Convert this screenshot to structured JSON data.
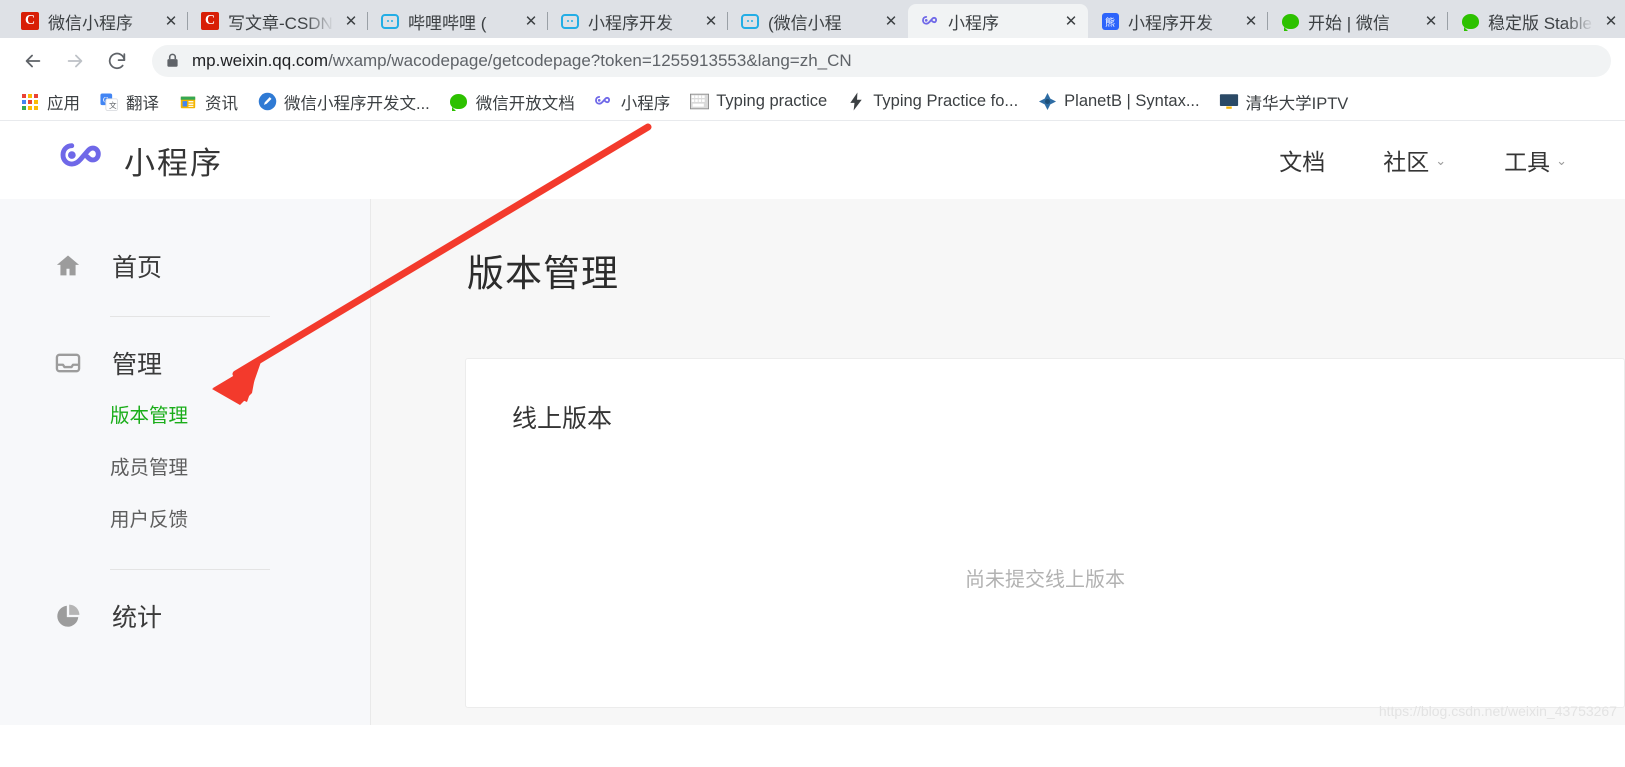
{
  "browser": {
    "tabs": [
      {
        "title": "微信小程序",
        "favicon": "csdn-icon",
        "active": false
      },
      {
        "title": "写文章-CSDN",
        "favicon": "csdn-icon",
        "active": false
      },
      {
        "title": "哔哩哔哩 (",
        "favicon": "bilibili-icon",
        "active": false
      },
      {
        "title": "小程序开发",
        "favicon": "bilibili-icon",
        "active": false
      },
      {
        "title": "(微信小程",
        "favicon": "bilibili-icon",
        "active": false
      },
      {
        "title": "小程序",
        "favicon": "weapp-icon",
        "active": true
      },
      {
        "title": "小程序开发",
        "favicon": "baidu-icon",
        "active": false
      },
      {
        "title": "开始 | 微信",
        "favicon": "wechat-icon",
        "active": false
      },
      {
        "title": "稳定版 Stable",
        "favicon": "wechat-icon",
        "active": false
      }
    ],
    "close_glyph": "✕",
    "new_tab_glyph": "+",
    "back_label": "←",
    "forward_label": "→",
    "reload_label": "⟳",
    "url": {
      "host": "mp.weixin.qq.com",
      "path": "/wxamp/wacodepage/getcodepage?token=1255913553&lang=zh_CN",
      "full": "mp.weixin.qq.com/wxamp/wacodepage/getcodepage?token=1255913553&lang=zh_CN"
    },
    "bookmarks": [
      {
        "label": "应用",
        "icon": "apps-grid-icon"
      },
      {
        "label": "翻译",
        "icon": "google-translate-icon"
      },
      {
        "label": "资讯",
        "icon": "google-news-icon"
      },
      {
        "label": "微信小程序开发文...",
        "icon": "weapp-doc-icon"
      },
      {
        "label": "微信开放文档",
        "icon": "wechat-icon"
      },
      {
        "label": "小程序",
        "icon": "weapp-icon"
      },
      {
        "label": "Typing practice",
        "icon": "keyboard-icon"
      },
      {
        "label": "Typing Practice fo...",
        "icon": "lightning-icon"
      },
      {
        "label": "PlanetB | Syntax...",
        "icon": "planetb-icon"
      },
      {
        "label": "清华大学IPTV",
        "icon": "monitor-icon"
      }
    ]
  },
  "site": {
    "brand": "小程序",
    "logo_icon": "weapp-logo-icon",
    "nav": [
      {
        "label": "文档",
        "has_chevron": false
      },
      {
        "label": "社区",
        "has_chevron": true
      },
      {
        "label": "工具",
        "has_chevron": true
      }
    ],
    "chevron_glyph": "⌄"
  },
  "sidebar": {
    "groups": [
      {
        "label": "首页",
        "icon": "home-icon",
        "items": []
      },
      {
        "label": "管理",
        "icon": "inbox-icon",
        "items": [
          {
            "label": "版本管理",
            "active": true
          },
          {
            "label": "成员管理",
            "active": false
          },
          {
            "label": "用户反馈",
            "active": false
          }
        ]
      },
      {
        "label": "统计",
        "icon": "pie-chart-icon",
        "items": []
      }
    ]
  },
  "main": {
    "page_title": "版本管理",
    "card": {
      "title": "线上版本",
      "empty_text": "尚未提交线上版本"
    }
  },
  "annotation": {
    "type": "red-arrow",
    "color": "#f33a2c",
    "points_to": "版本管理"
  },
  "watermark": "https://blog.csdn.net/weixin_43753267",
  "colors": {
    "accent_green": "#1aad19",
    "brand_purple": "#6f68e8",
    "page_bg": "#f7f7f7",
    "sidebar_bg": "#f7f8fa",
    "annotation_red": "#f33a2c"
  }
}
